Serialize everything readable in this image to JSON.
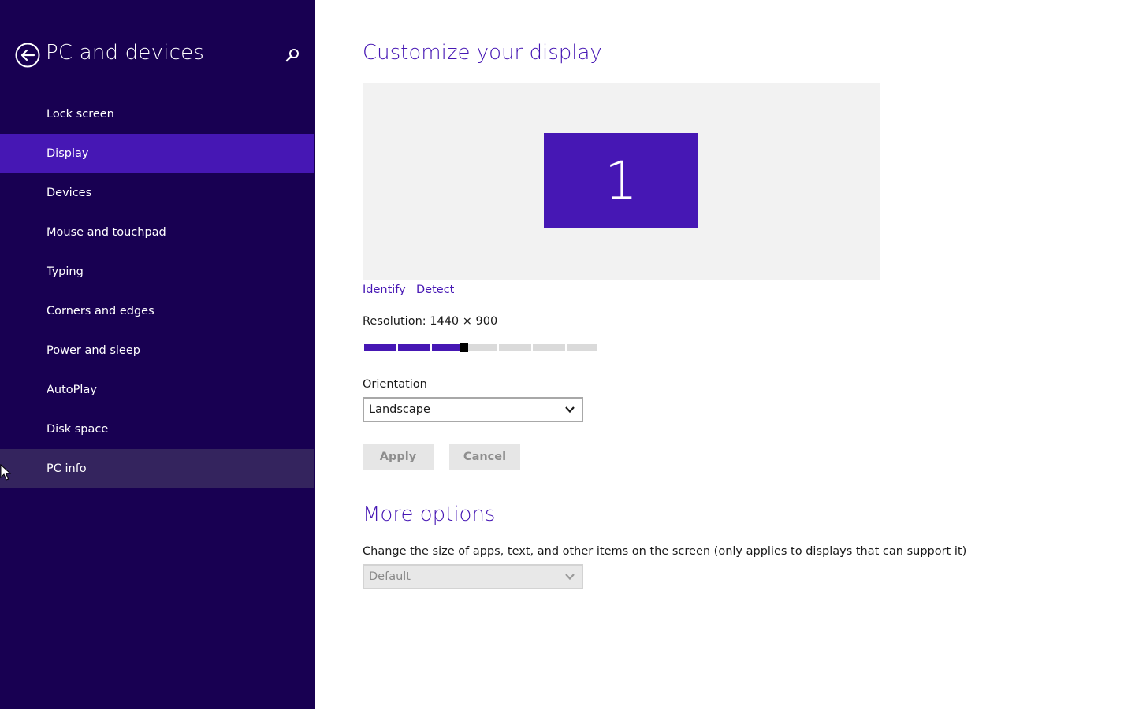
{
  "sidebar": {
    "title": "PC and devices",
    "items": [
      {
        "label": "Lock screen",
        "state": ""
      },
      {
        "label": "Display",
        "state": "selected"
      },
      {
        "label": "Devices",
        "state": ""
      },
      {
        "label": "Mouse and touchpad",
        "state": ""
      },
      {
        "label": "Typing",
        "state": ""
      },
      {
        "label": "Corners and edges",
        "state": ""
      },
      {
        "label": "Power and sleep",
        "state": ""
      },
      {
        "label": "AutoPlay",
        "state": ""
      },
      {
        "label": "Disk space",
        "state": ""
      },
      {
        "label": "PC info",
        "state": "hover"
      }
    ],
    "icons": {
      "back": "back-arrow-circle-icon",
      "search": "search-icon",
      "cursor": "mouse-pointer-icon"
    }
  },
  "main": {
    "title": "Customize your display",
    "monitor_number": "1",
    "identify_label": "Identify",
    "detect_label": "Detect",
    "resolution_text": "Resolution: 1440 × 900",
    "resolution_slider": {
      "value_fraction": 0.43,
      "steps": 7
    },
    "orientation_label": "Orientation",
    "orientation_value": "Landscape",
    "apply_label": "Apply",
    "cancel_label": "Cancel",
    "more_options_title": "More options",
    "size_description": "Change the size of apps, text, and other items on the screen (only applies to displays that can support it)",
    "size_value": "Default"
  },
  "colors": {
    "sidebar_bg": "#180052",
    "accent": "#4617b4",
    "hover_bg": "#34245e",
    "preview_bg": "#f2f2f2",
    "button_bg": "#e6e6e6"
  }
}
